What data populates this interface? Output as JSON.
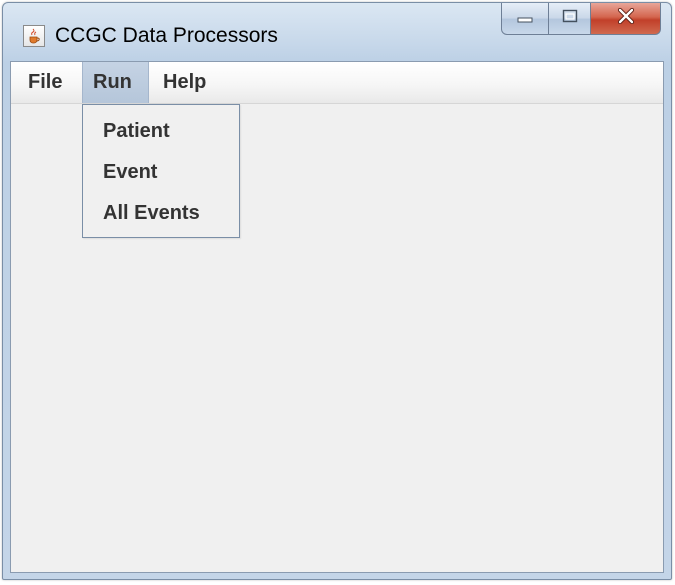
{
  "window": {
    "title": "CCGC Data Processors",
    "controls": {
      "minimize_icon": "minimize-icon",
      "maximize_icon": "maximize-icon",
      "close_icon": "close-icon"
    },
    "app_icon": "java-cup-icon"
  },
  "menubar": {
    "items": [
      {
        "label": "File"
      },
      {
        "label": "Run",
        "active": true
      },
      {
        "label": "Help"
      }
    ]
  },
  "run_menu": {
    "items": [
      {
        "label": "Patient"
      },
      {
        "label": "Event"
      },
      {
        "label": "All Events"
      }
    ]
  },
  "colors": {
    "titlebar": "#c7d8ea",
    "client_bg": "#f0f0f0",
    "active_menu": "#b5c6da",
    "close_button": "#c1402a",
    "menu_text": "#333333"
  }
}
